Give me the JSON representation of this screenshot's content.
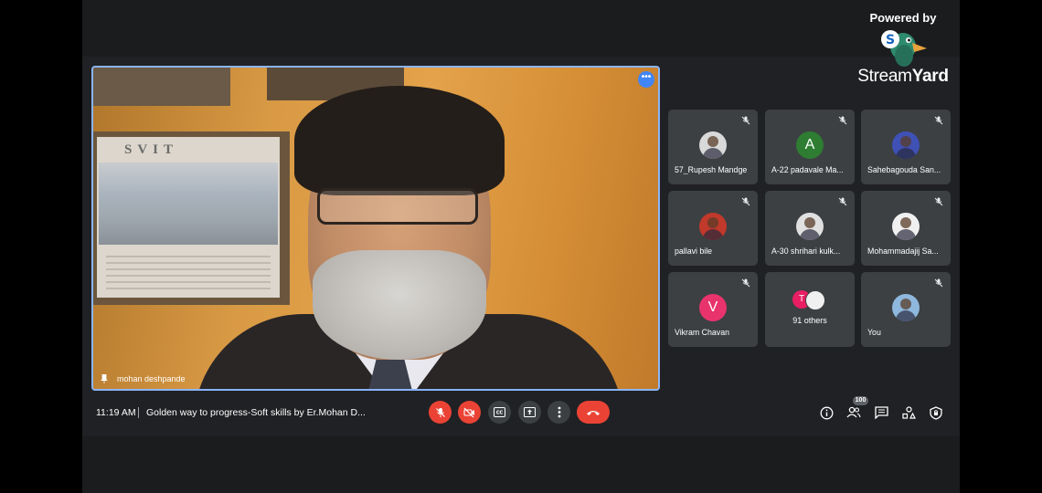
{
  "branding": {
    "powered_by": "Powered by",
    "name_part1": "Stream",
    "name_part2": "Yard",
    "logo_letter": "S"
  },
  "main_video": {
    "speaker_name": "mohan deshpande",
    "poster_text": "SVIT",
    "more_icon": "more-options-icon"
  },
  "participants": [
    {
      "name": "57_Rupesh Mandge",
      "avatar_type": "image",
      "avatar_color": "#d9d9d9",
      "muted": true
    },
    {
      "name": "A-22 padavale Ma...",
      "avatar_type": "letter",
      "avatar_letter": "A",
      "avatar_color": "#2e7d32",
      "muted": true
    },
    {
      "name": "Sahebagouda San...",
      "avatar_type": "image",
      "avatar_color": "#3f51b5",
      "muted": true
    },
    {
      "name": "pallavi bile",
      "avatar_type": "image",
      "avatar_color": "#c0392b",
      "muted": true
    },
    {
      "name": "A-30 shrihari kulk...",
      "avatar_type": "image",
      "avatar_color": "#e0e0e0",
      "muted": true
    },
    {
      "name": "Mohammadajij Sa...",
      "avatar_type": "image",
      "avatar_color": "#f0f0f0",
      "muted": true
    },
    {
      "name": "Vikram Chavan",
      "avatar_type": "letter",
      "avatar_letter": "V",
      "avatar_color": "#e8336d",
      "muted": true
    },
    {
      "name": "91 others",
      "avatar_type": "group",
      "avatar_letter": "T",
      "avatar_color": "#e91e63",
      "muted": false
    },
    {
      "name": "You",
      "avatar_type": "image",
      "avatar_color": "#8fb8de",
      "muted": true
    }
  ],
  "toolbar": {
    "time": "11:19 AM",
    "meeting_title": "Golden way to progress-Soft skills by Er.Mohan D...",
    "participant_count": "100",
    "colors": {
      "danger": "#ea4335",
      "neutral": "#3c4043"
    }
  }
}
